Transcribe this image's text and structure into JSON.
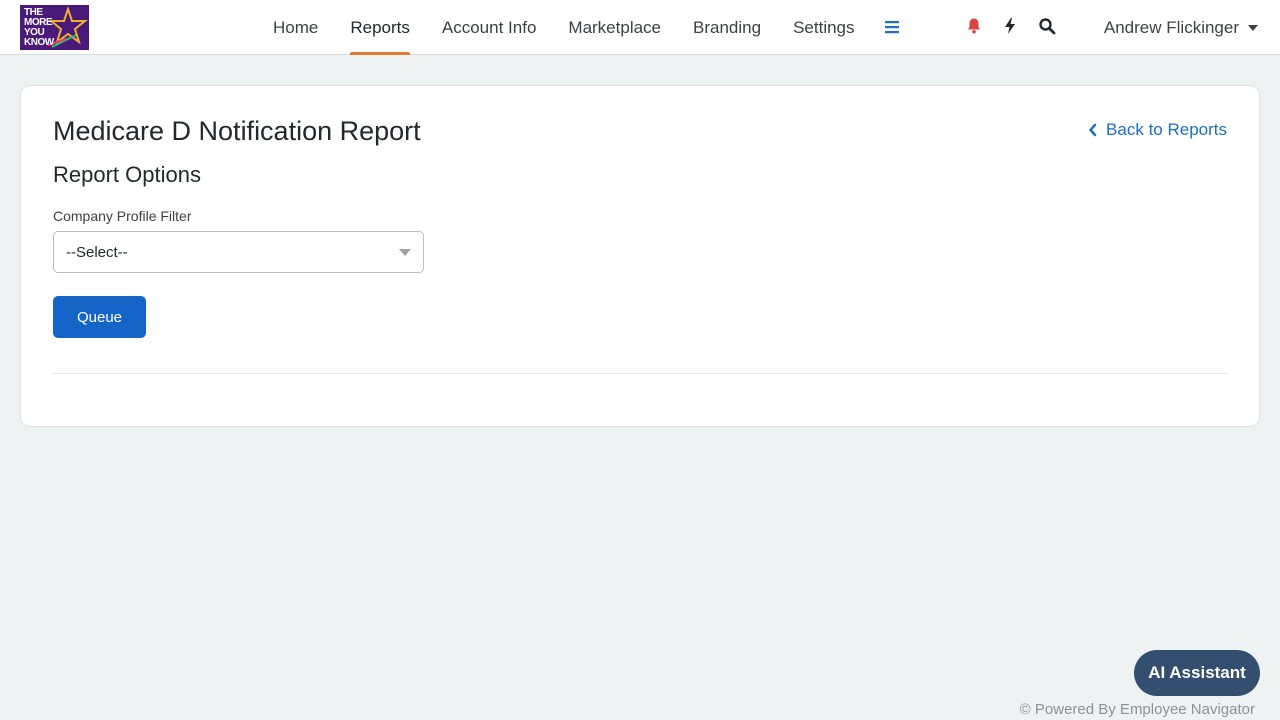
{
  "logo": {
    "line1": "THE",
    "line2": "MORE",
    "line3": "YOU",
    "line4": "KNOW"
  },
  "nav": {
    "items": [
      {
        "label": "Home",
        "active": false
      },
      {
        "label": "Reports",
        "active": true
      },
      {
        "label": "Account Info",
        "active": false
      },
      {
        "label": "Marketplace",
        "active": false
      },
      {
        "label": "Branding",
        "active": false
      },
      {
        "label": "Settings",
        "active": false
      }
    ],
    "user": "Andrew Flickinger"
  },
  "page": {
    "title": "Medicare D Notification Report",
    "back_link": "Back to Reports",
    "section_title": "Report Options",
    "filter_label": "Company Profile Filter",
    "filter_value": "--Select--",
    "queue_label": "Queue"
  },
  "assistant": {
    "label": "AI Assistant"
  },
  "footer": {
    "text": "© Powered By Employee Navigator"
  },
  "colors": {
    "accent": "#1565c8",
    "active_tab_underline": "#e07a30",
    "bell": "#d9443f",
    "assistant": "#334e6e"
  },
  "icons": {
    "more": "hamburger-icon",
    "notifications": "bell-icon",
    "quick_actions": "bolt-icon",
    "search": "search-icon",
    "back": "chevron-left-icon"
  }
}
